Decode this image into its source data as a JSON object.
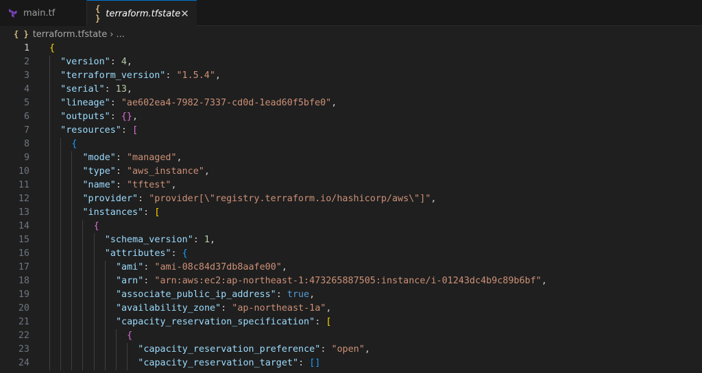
{
  "tabs": [
    {
      "label": "main.tf",
      "icon": "terraform-icon"
    },
    {
      "label": "terraform.tfstate",
      "icon": "json-braces-icon"
    }
  ],
  "breadcrumb": {
    "file": "terraform.tfstate",
    "separator": "›",
    "more": "..."
  },
  "editor": {
    "lines": [
      {
        "n": "1",
        "ind": 0,
        "t": [
          [
            "br1",
            "{"
          ]
        ]
      },
      {
        "n": "2",
        "ind": 1,
        "t": [
          [
            "k",
            "\"version\""
          ],
          [
            "p",
            ": "
          ],
          [
            "n",
            "4"
          ],
          [
            "p",
            ","
          ]
        ]
      },
      {
        "n": "3",
        "ind": 1,
        "t": [
          [
            "k",
            "\"terraform_version\""
          ],
          [
            "p",
            ": "
          ],
          [
            "s",
            "\"1.5.4\""
          ],
          [
            "p",
            ","
          ]
        ]
      },
      {
        "n": "4",
        "ind": 1,
        "t": [
          [
            "k",
            "\"serial\""
          ],
          [
            "p",
            ": "
          ],
          [
            "n",
            "13"
          ],
          [
            "p",
            ","
          ]
        ]
      },
      {
        "n": "5",
        "ind": 1,
        "t": [
          [
            "k",
            "\"lineage\""
          ],
          [
            "p",
            ": "
          ],
          [
            "s",
            "\"ae602ea4-7982-7337-cd0d-1ead60f5bfe0\""
          ],
          [
            "p",
            ","
          ]
        ]
      },
      {
        "n": "6",
        "ind": 1,
        "t": [
          [
            "k",
            "\"outputs\""
          ],
          [
            "p",
            ": "
          ],
          [
            "br2",
            "{}"
          ],
          [
            "p",
            ","
          ]
        ]
      },
      {
        "n": "7",
        "ind": 1,
        "t": [
          [
            "k",
            "\"resources\""
          ],
          [
            "p",
            ": "
          ],
          [
            "br2",
            "["
          ]
        ]
      },
      {
        "n": "8",
        "ind": 2,
        "t": [
          [
            "br3",
            "{"
          ]
        ]
      },
      {
        "n": "9",
        "ind": 3,
        "t": [
          [
            "k",
            "\"mode\""
          ],
          [
            "p",
            ": "
          ],
          [
            "s",
            "\"managed\""
          ],
          [
            "p",
            ","
          ]
        ]
      },
      {
        "n": "10",
        "ind": 3,
        "t": [
          [
            "k",
            "\"type\""
          ],
          [
            "p",
            ": "
          ],
          [
            "s",
            "\"aws_instance\""
          ],
          [
            "p",
            ","
          ]
        ]
      },
      {
        "n": "11",
        "ind": 3,
        "t": [
          [
            "k",
            "\"name\""
          ],
          [
            "p",
            ": "
          ],
          [
            "s",
            "\"tftest\""
          ],
          [
            "p",
            ","
          ]
        ]
      },
      {
        "n": "12",
        "ind": 3,
        "t": [
          [
            "k",
            "\"provider\""
          ],
          [
            "p",
            ": "
          ],
          [
            "s",
            "\"provider[\\\"registry.terraform.io/hashicorp/aws\\\"]\""
          ],
          [
            "p",
            ","
          ]
        ]
      },
      {
        "n": "13",
        "ind": 3,
        "t": [
          [
            "k",
            "\"instances\""
          ],
          [
            "p",
            ": "
          ],
          [
            "br1",
            "["
          ]
        ]
      },
      {
        "n": "14",
        "ind": 4,
        "t": [
          [
            "br2",
            "{"
          ]
        ]
      },
      {
        "n": "15",
        "ind": 5,
        "t": [
          [
            "k",
            "\"schema_version\""
          ],
          [
            "p",
            ": "
          ],
          [
            "n",
            "1"
          ],
          [
            "p",
            ","
          ]
        ]
      },
      {
        "n": "16",
        "ind": 5,
        "t": [
          [
            "k",
            "\"attributes\""
          ],
          [
            "p",
            ": "
          ],
          [
            "br3",
            "{"
          ]
        ]
      },
      {
        "n": "17",
        "ind": 6,
        "t": [
          [
            "k",
            "\"ami\""
          ],
          [
            "p",
            ": "
          ],
          [
            "s",
            "\"ami-08c84d37db8aafe00\""
          ],
          [
            "p",
            ","
          ]
        ]
      },
      {
        "n": "18",
        "ind": 6,
        "t": [
          [
            "k",
            "\"arn\""
          ],
          [
            "p",
            ": "
          ],
          [
            "s",
            "\"arn:aws:ec2:ap-northeast-1:473265887505:instance/i-01243dc4b9c89b6bf\""
          ],
          [
            "p",
            ","
          ]
        ]
      },
      {
        "n": "19",
        "ind": 6,
        "t": [
          [
            "k",
            "\"associate_public_ip_address\""
          ],
          [
            "p",
            ": "
          ],
          [
            "b",
            "true"
          ],
          [
            "p",
            ","
          ]
        ]
      },
      {
        "n": "20",
        "ind": 6,
        "t": [
          [
            "k",
            "\"availability_zone\""
          ],
          [
            "p",
            ": "
          ],
          [
            "s",
            "\"ap-northeast-1a\""
          ],
          [
            "p",
            ","
          ]
        ]
      },
      {
        "n": "21",
        "ind": 6,
        "t": [
          [
            "k",
            "\"capacity_reservation_specification\""
          ],
          [
            "p",
            ": "
          ],
          [
            "br1",
            "["
          ]
        ]
      },
      {
        "n": "22",
        "ind": 7,
        "t": [
          [
            "br2",
            "{"
          ]
        ]
      },
      {
        "n": "23",
        "ind": 8,
        "t": [
          [
            "k",
            "\"capacity_reservation_preference\""
          ],
          [
            "p",
            ": "
          ],
          [
            "s",
            "\"open\""
          ],
          [
            "p",
            ","
          ]
        ]
      },
      {
        "n": "24",
        "ind": 8,
        "t": [
          [
            "k",
            "\"capacity_reservation_target\""
          ],
          [
            "p",
            ": "
          ],
          [
            "br3",
            "[]"
          ]
        ]
      }
    ]
  },
  "colors": {
    "key": "#9cdcfe",
    "string": "#ce9178",
    "number": "#b5cea8",
    "boolean": "#569cd6",
    "bracket1": "#ffd700",
    "bracket2": "#da70d6",
    "bracket3": "#179fff"
  }
}
